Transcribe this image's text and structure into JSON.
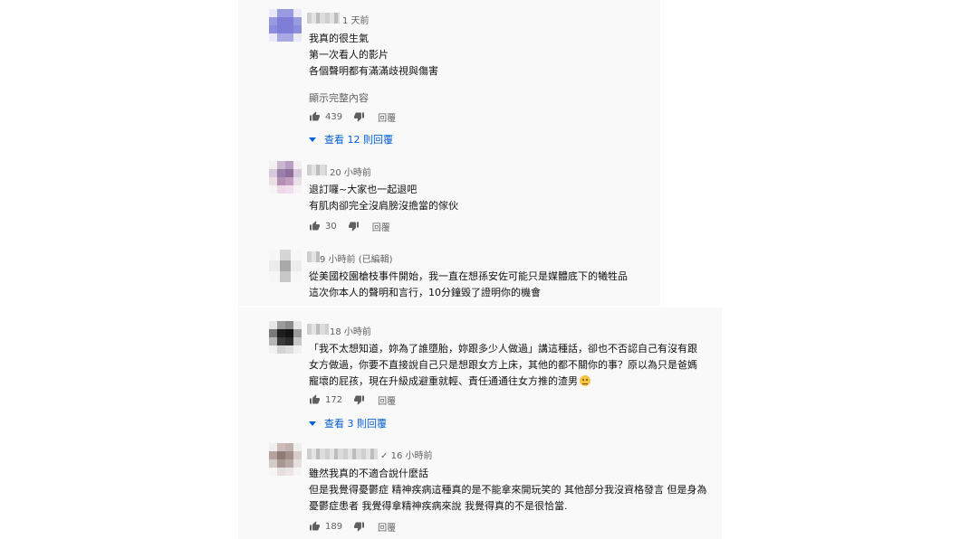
{
  "comments": [
    {
      "time": "1 天前",
      "lines": [
        "我真的很生氣",
        "第一次看人的影片",
        "各個聲明都有滿滿歧視與傷害"
      ],
      "show_more": "顯示完整內容",
      "likes": "439",
      "reply_label": "回覆",
      "replies_label": "查看 12 則回覆"
    },
    {
      "time": "20 小時前",
      "lines": [
        "退訂囉~大家也一起退吧",
        "有肌肉卻完全沒肩膀沒擔當的傢伙"
      ],
      "likes": "30",
      "reply_label": "回覆"
    },
    {
      "time": "9 小時前 (已編輯)",
      "lines": [
        "從美國校園槍枝事件開始，我一直在想孫安佐可能只是媒體底下的犧牲品",
        "這次你本人的聲明和言行，10分鐘毀了證明你的機會"
      ]
    },
    {
      "time": "18 小時前",
      "lines": [
        "「我不太想知道，妳為了誰墮胎，妳跟多少人做過」講這種話，卻也不否認自己有沒有跟",
        "女方做過，你要不直接說自己只是想跟女方上床，其他的都不關你的事？原以為只是爸媽",
        "寵壞的屁孩，現在升級成避重就輕、責任通通往女方推的渣男"
      ],
      "likes": "172",
      "reply_label": "回覆",
      "replies_label": "查看 3 則回覆"
    },
    {
      "time": "16 小時前",
      "lines": [
        "雖然我真的不適合說什麼話",
        "但是我覺得憂鬱症 精神疾病這種真的是不能拿來開玩笑的 其他部分我沒資格發言 但是身為",
        "憂鬱症患者 我覺得拿精神疾病來說 我覺得真的不是很恰當."
      ],
      "likes": "189",
      "reply_label": "回覆"
    }
  ],
  "icons": {
    "like": "thumbs-up-icon",
    "dislike": "thumbs-down-icon",
    "replies_toggle": "caret-down-icon",
    "verified": "check-icon",
    "emoji": "unamused-face-emoji"
  },
  "colors": {
    "link": "#065fd4",
    "meta": "#606060",
    "panel": "#f9f9f9"
  }
}
